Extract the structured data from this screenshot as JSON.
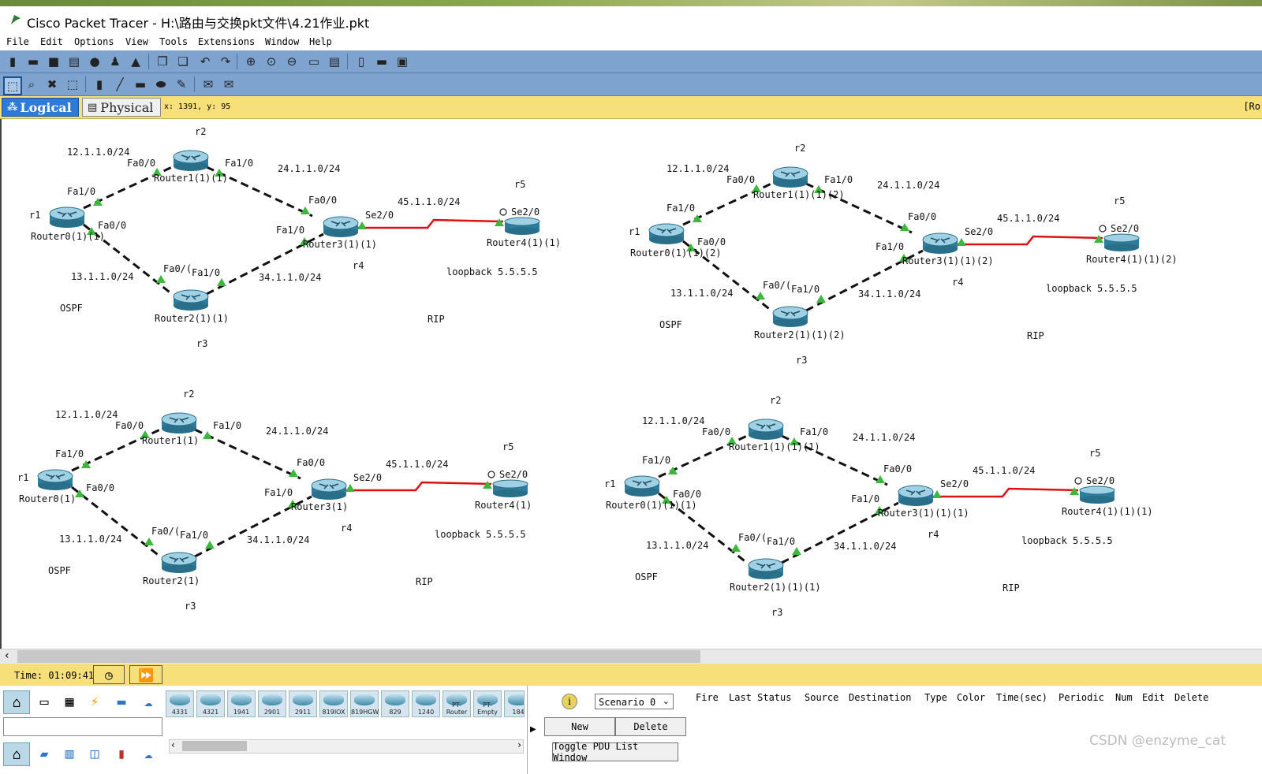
{
  "window": {
    "title": "Cisco Packet Tracer - H:\\路由与交换pkt文件\\4.21作业.pkt"
  },
  "menu": [
    "File",
    "Edit",
    "Options",
    "View",
    "Tools",
    "Extensions",
    "Window",
    "Help"
  ],
  "mode": {
    "logical": "Logical",
    "physical": "Physical",
    "coords": "x: 1391, y: 95",
    "right_text": "[Ro"
  },
  "topologies": [
    {
      "labels": [
        "r1",
        "r2",
        "r3",
        "r4",
        "r5",
        "12.1.1.0/24",
        "24.1.1.0/24",
        "13.1.1.0/24",
        "34.1.1.0/24",
        "45.1.1.0/24",
        "Fa0/0",
        "Fa1/0",
        "Fa1/0",
        "Fa0/0",
        "Fa0/(",
        "Fa1/0",
        "Fa0/0",
        "Fa1/0",
        "Se2/0",
        "Se2/0",
        "Router0(1)(1)",
        "Router1(1)(1)",
        "Router2(1)(1)",
        "Router3(1)(1)",
        "Router4(1)(1)",
        "loopback  5.5.5.5",
        "OSPF",
        "RIP"
      ]
    },
    {
      "labels": [
        "r1",
        "r2",
        "r3",
        "r4",
        "r5",
        "12.1.1.0/24",
        "24.1.1.0/24",
        "13.1.1.0/24",
        "34.1.1.0/24",
        "45.1.1.0/24",
        "Fa0/0",
        "Fa1/0",
        "Fa1/0",
        "Fa0/0",
        "Fa0/(",
        "Fa1/0",
        "Fa0/0",
        "Fa1/0",
        "Se2/0",
        "Se2/0",
        "Router0(1)(1)(2)",
        "Router1(1)(1)(2)",
        "Router2(1)(1)(2)",
        "Router3(1)(1)(2)",
        "Router4(1)(1)(2)",
        "loopback  5.5.5.5",
        "OSPF",
        "RIP"
      ]
    },
    {
      "labels": [
        "r1",
        "r2",
        "r3",
        "r4",
        "r5",
        "12.1.1.0/24",
        "24.1.1.0/24",
        "13.1.1.0/24",
        "34.1.1.0/24",
        "45.1.1.0/24",
        "Fa0/0",
        "Fa1/0",
        "Fa1/0",
        "Fa0/0",
        "Fa0/(",
        "Fa1/0",
        "Fa0/0",
        "Fa1/0",
        "Se2/0",
        "Se2/0",
        "Router0(1)",
        "Router1(1)",
        "Router2(1)",
        "Router3(1)",
        "Router4(1)",
        "loopback  5.5.5.5",
        "OSPF",
        "RIP"
      ]
    },
    {
      "labels": [
        "r1",
        "r2",
        "r3",
        "r4",
        "r5",
        "12.1.1.0/24",
        "24.1.1.0/24",
        "13.1.1.0/24",
        "34.1.1.0/24",
        "45.1.1.0/24",
        "Fa0/0",
        "Fa1/0",
        "Fa1/0",
        "Fa0/0",
        "Fa0/(",
        "Fa1/0",
        "Fa0/0",
        "Fa1/0",
        "Se2/0",
        "Se2/0",
        "Router0(1)(1)(1)",
        "Router1(1)(1)(1)",
        "Router2(1)(1)(1)",
        "Router3(1)(1)(1)",
        "Router4(1)(1)(1)",
        "loopback  5.5.5.5",
        "OSPF",
        "RIP"
      ]
    }
  ],
  "status": {
    "time": "Time: 01:09:41"
  },
  "devices": [
    "4331",
    "4321",
    "1941",
    "2901",
    "2911",
    "819IOX",
    "819HGW",
    "829",
    "1240",
    "PT-Router",
    "PT-Empty",
    "184"
  ],
  "scenario": {
    "selected": "Scenario 0",
    "new": "New",
    "delete": "Delete",
    "toggle": "Toggle PDU List Window"
  },
  "pdu_headers": [
    "Fire",
    "Last Status",
    "Source",
    "Destination",
    "Type",
    "Color",
    "Time(sec)",
    "Periodic",
    "Num",
    "Edit",
    "Delete"
  ],
  "watermark": "CSDN @enzyme_cat",
  "colors": {
    "toolbar": "#7ea3cf",
    "modebar": "#f7df7a",
    "serial_link": "#e01010",
    "port_up": "#3cb83c"
  }
}
